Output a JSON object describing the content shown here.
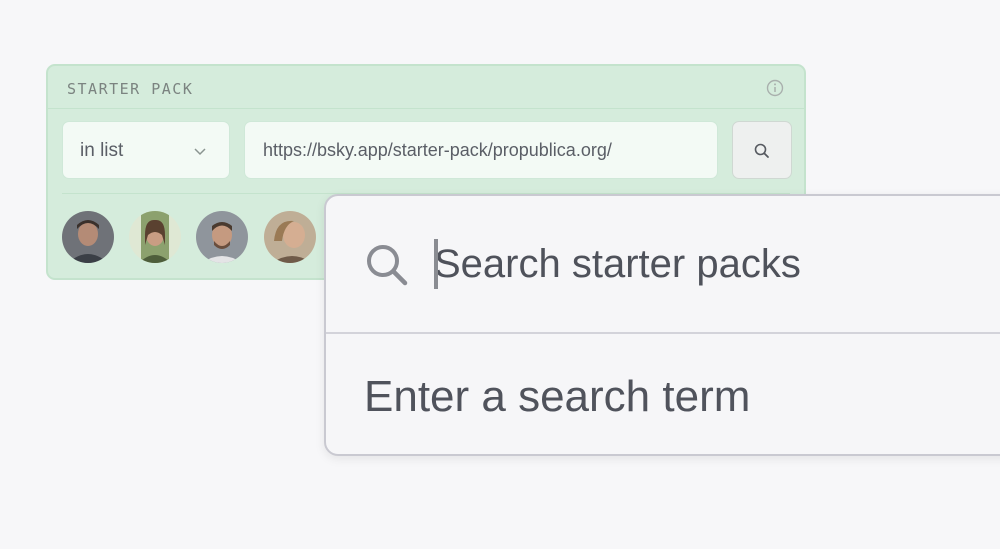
{
  "starter_pack": {
    "title": "STARTER PACK",
    "list_mode": "in list",
    "url_value": "https://bsky.app/starter-pack/propublica.org/"
  },
  "search": {
    "placeholder": "Search starter packs",
    "empty_message": "Enter a search term"
  },
  "icons": {
    "info": "info-icon",
    "chevron": "chevron-down-icon",
    "search": "search-icon"
  },
  "colors": {
    "card_background": "#d5ecdc",
    "card_border": "#c4e3cd",
    "panel_background": "#f6f6f8"
  }
}
